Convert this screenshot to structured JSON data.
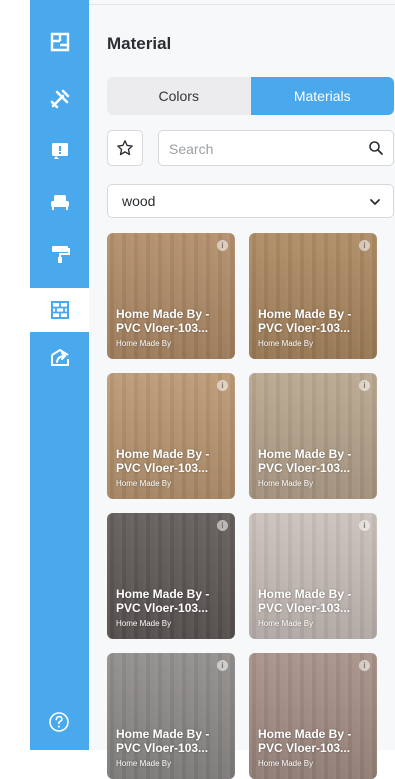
{
  "sidebar": {
    "items": [
      {
        "icon": "floorplan-icon",
        "active": false
      },
      {
        "icon": "tools-icon",
        "active": false
      },
      {
        "icon": "door-icon",
        "active": false
      },
      {
        "icon": "sofa-icon",
        "active": false
      },
      {
        "icon": "paint-roller-icon",
        "active": false
      },
      {
        "icon": "brick-wall-icon",
        "active": true
      },
      {
        "icon": "export-icon",
        "active": false
      }
    ],
    "help_icon": "help-icon"
  },
  "panel": {
    "title": "Material",
    "tabs": [
      {
        "label": "Colors",
        "active": false
      },
      {
        "label": "Materials",
        "active": true
      }
    ],
    "search": {
      "placeholder": "Search",
      "value": ""
    },
    "filter": {
      "selected": "wood"
    },
    "accent": "#4aa8ec",
    "materials": [
      {
        "line1": "Home Made By -",
        "line2": "PVC Vloer-103...",
        "brand": "Home Made By",
        "color": "#b08b66"
      },
      {
        "line1": "Home Made By -",
        "line2": "PVC Vloer-103...",
        "brand": "Home Made By",
        "color": "#ab875f"
      },
      {
        "line1": "Home Made By -",
        "line2": "PVC Vloer-103...",
        "brand": "Home Made By",
        "color": "#ba9670"
      },
      {
        "line1": "Home Made By -",
        "line2": "PVC Vloer-103...",
        "brand": "Home Made By",
        "color": "#b7a48c"
      },
      {
        "line1": "Home Made By -",
        "line2": "PVC Vloer-103...",
        "brand": "Home Made By",
        "color": "#5e5855"
      },
      {
        "line1": "Home Made By -",
        "line2": "PVC Vloer-103...",
        "brand": "Home Made By",
        "color": "#c9bfba"
      },
      {
        "line1": "Home Made By -",
        "line2": "PVC Vloer-103...",
        "brand": "Home Made By",
        "color": "#8d8a88"
      },
      {
        "line1": "Home Made By -",
        "line2": "PVC Vloer-103...",
        "brand": "Home Made By",
        "color": "#a58e84"
      }
    ]
  }
}
